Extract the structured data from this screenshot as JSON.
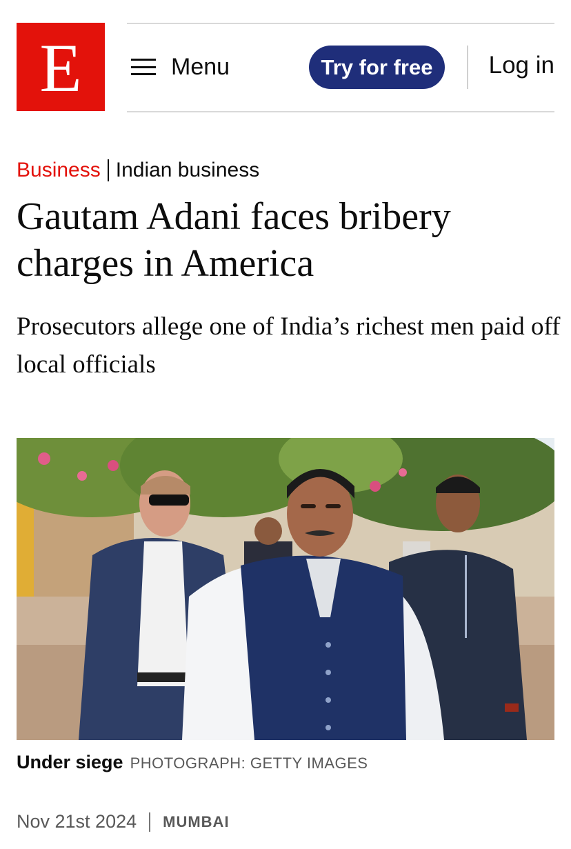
{
  "header": {
    "logo_letter": "E",
    "menu_label": "Menu",
    "try_label": "Try for free",
    "login_label": "Log in"
  },
  "article": {
    "section": "Business",
    "subsection": "Indian business",
    "headline": "Gautam Adani faces bribery charges in America",
    "subheadline": "Prosecutors allege one of India’s richest men paid off local officials",
    "image": {
      "caption_title": "Under siege",
      "caption_credit": "PHOTOGRAPH: GETTY IMAGES"
    },
    "date": "Nov 21st 2024",
    "location": "MUMBAI"
  },
  "colors": {
    "brand_red": "#e3120b",
    "cta_blue": "#1f2e7a",
    "text": "#0d0d0d",
    "muted": "#595959"
  },
  "icons": [
    "hamburger-icon"
  ]
}
